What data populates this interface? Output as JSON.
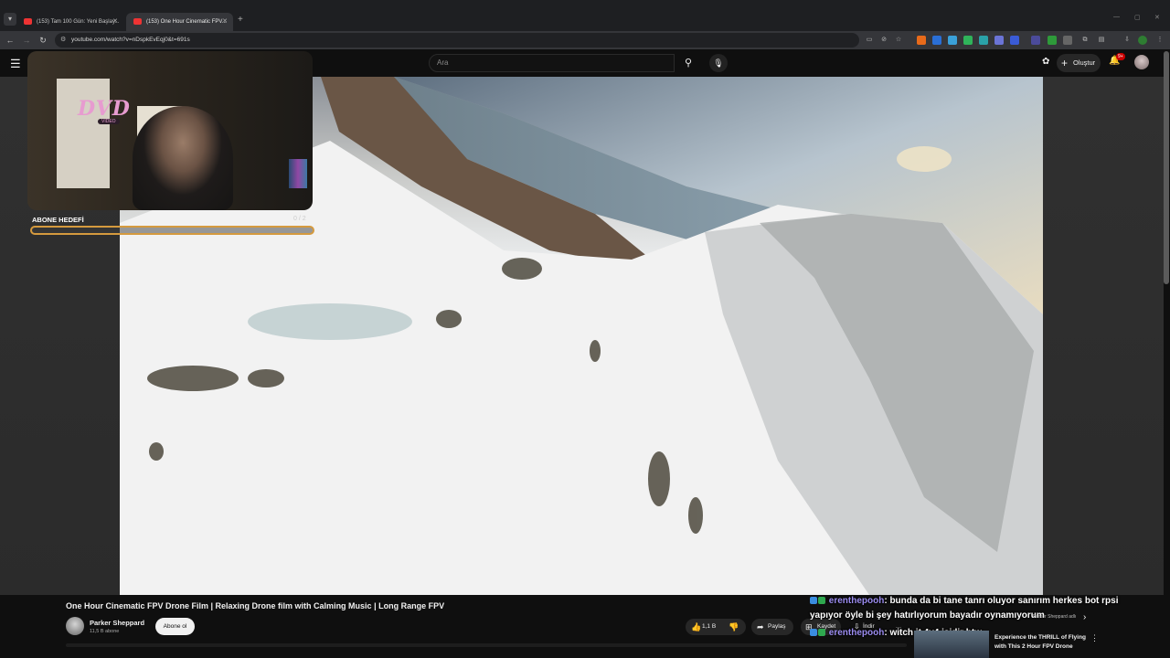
{
  "browser": {
    "tabs": [
      {
        "label": "(153) Tam 100 Gün: Yeni Başlay...",
        "active": false
      },
      {
        "label": "(153) One Hour Cinematic FPV...",
        "active": true
      }
    ],
    "url": "youtube.com/watch?v=nDspkEvEqj0&t=691s"
  },
  "youtube": {
    "search_placeholder": "Ara",
    "create_label": "Oluştur",
    "notif_count": "9+"
  },
  "overlay": {
    "dvd_logo": "DVD",
    "dvd_sub": "VIDEO",
    "goal_label": "ABONE HEDEFİ",
    "goal_count": "0 / 2",
    "goal_progress": 0.0
  },
  "video": {
    "title": "One Hour Cinematic FPV Drone Film | Relaxing Drone film with Calming Music | Long Range FPV",
    "channel": "Parker Sheppard",
    "subscribers": "11,5 B abone",
    "subscribe_label": "Abone ol",
    "likes": "1,1 B",
    "share_label": "Paylaş",
    "save_label": "Kaydet",
    "download_label": "İndir"
  },
  "chat": [
    {
      "user": "erenthepooh",
      "text": ": bunda da bi tane tanrı oluyor sanırım herkes bot rpsi"
    },
    {
      "user": "",
      "text": "yapıyor öyle bi şey hatırlıyorum bayadır oynamıyorum"
    },
    {
      "user": "erenthepooh",
      "text": ": witch it 4v4 işidir btw"
    }
  ],
  "recommendation": {
    "title": "Experience the THRILL of Flying with This 2 Hour FPV Drone",
    "channel_hint": "Parker Sheppard adlı"
  },
  "colors": {
    "accent_goal": "#d59a3e",
    "chat_user": "#9b8cf0",
    "youtube_red": "#cc0000"
  }
}
